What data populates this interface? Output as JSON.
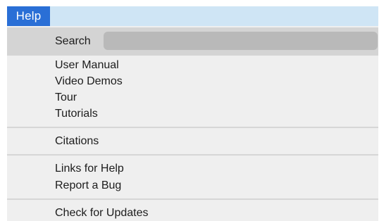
{
  "menubar": {
    "active_menu": "Help"
  },
  "search": {
    "label": "Search",
    "value": "",
    "placeholder": ""
  },
  "groups": [
    {
      "items": [
        "User Manual",
        "Video Demos",
        "Tour",
        "Tutorials"
      ]
    },
    {
      "items": [
        "Citations"
      ]
    },
    {
      "items": [
        "Links for Help",
        "Report a Bug"
      ]
    },
    {
      "items": [
        "Check for Updates"
      ]
    }
  ],
  "colors": {
    "menubar_bg": "#cfe5f5",
    "active_menu_bg": "#2a6fd6",
    "menu_bg": "#efefef",
    "search_row_bg": "#d4d4d4"
  }
}
